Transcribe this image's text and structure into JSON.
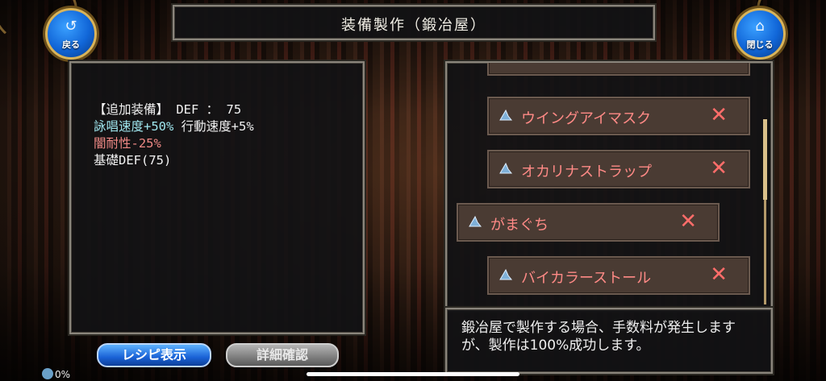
{
  "header": {
    "title": "装備製作（鍛冶屋）"
  },
  "nav": {
    "back_label": "戻る",
    "back_icon": "back-arrow-icon",
    "close_label": "閉じる",
    "close_icon": "home-icon"
  },
  "stats": {
    "line1": "【追加装備】 DEF ： 75",
    "line2_cyan": "詠唱速度+50%",
    "line2_rest": " 行動速度+5%",
    "line3": "闇耐性-25%",
    "line4": "基礎DEF(75)"
  },
  "materials": {
    "items": [
      {
        "name": "ウイングアイマスク",
        "icon": "hat-icon"
      },
      {
        "name": "オカリナストラップ",
        "icon": "hat-icon"
      },
      {
        "name": "がまぐち",
        "icon": "hat-icon"
      },
      {
        "name": "バイカラーストール",
        "icon": "hat-icon"
      }
    ],
    "remove_symbol": "✕"
  },
  "note": {
    "text": "鍛冶屋で製作する場合、手数料が発生しますが、製作は100%成功します。"
  },
  "buttons": {
    "recipe": "レシピ表示",
    "detail": "詳細確認"
  },
  "progress": {
    "value": "0%"
  },
  "colors": {
    "accent_blue": "#1a62d6",
    "item_text": "#ff8a86",
    "stat_cyan": "#9fe6ee",
    "stat_red": "#f08a86"
  }
}
